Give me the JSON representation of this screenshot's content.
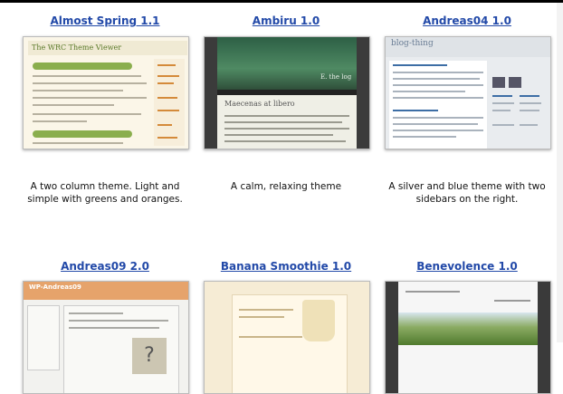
{
  "themes": [
    {
      "title": "Almost Spring 1.1",
      "description": "A two column theme. Light and simple with greens and oranges.",
      "thumb_text": "The WRC Theme Viewer"
    },
    {
      "title": "Ambiru 1.0",
      "description": "A calm, relaxing theme",
      "thumb_text": "Maecenas at libero"
    },
    {
      "title": "Andreas04 1.0",
      "description": "A silver and blue theme with two sidebars on the right.",
      "thumb_text": "blog-thing"
    },
    {
      "title": "Andreas09 2.0",
      "description": "",
      "thumb_text": "WP-Andreas09"
    },
    {
      "title": "Banana Smoothie 1.0",
      "description": "",
      "thumb_text": ""
    },
    {
      "title": "Benevolence 1.0",
      "description": "",
      "thumb_text": ""
    }
  ]
}
